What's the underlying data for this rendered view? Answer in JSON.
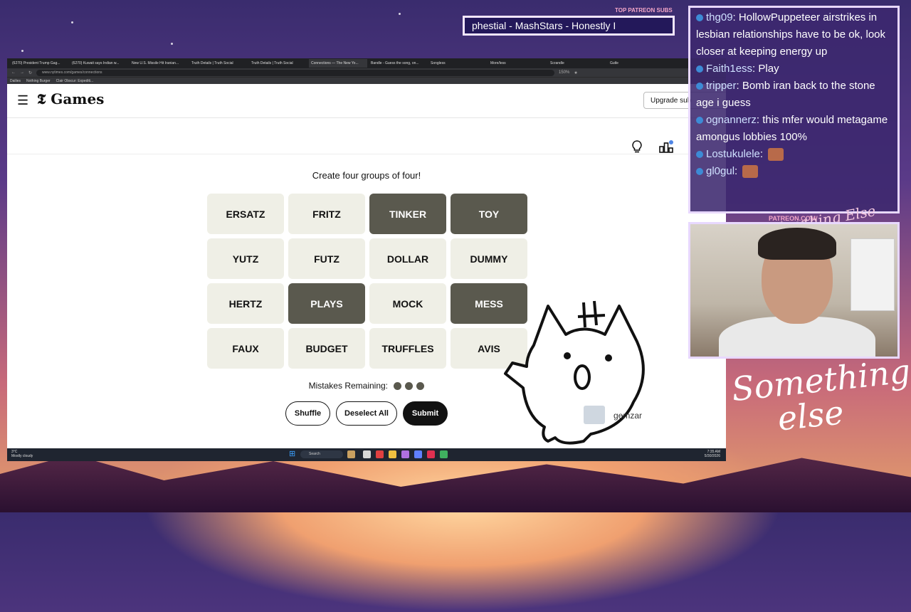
{
  "browser": {
    "tabs": [
      "(6270) President Trump Gag...",
      "(6270) Kuwait says Indian w...",
      "New U.S. Missile Hit Iranian...",
      "Truth Details | Truth Social",
      "Truth Details | Truth Social",
      "Connections — The New Yo...",
      "Bandle - Guess the song, on...",
      "Songless",
      "More/less",
      "Scrandle",
      "Gutle"
    ],
    "active_tab_index": 5,
    "url": "www.nytimes.com/games/connections",
    "bookmarks": [
      "Dailies",
      "Nothing Burger",
      "Clair Obscur: Expediti..."
    ],
    "zoom": "150%"
  },
  "header": {
    "logo": "Games",
    "upgrade_label": "Upgrade sub"
  },
  "game": {
    "instruction": "Create four groups of four!",
    "tiles": [
      {
        "word": "ERSATZ",
        "selected": false
      },
      {
        "word": "FRITZ",
        "selected": false
      },
      {
        "word": "TINKER",
        "selected": true
      },
      {
        "word": "TOY",
        "selected": true
      },
      {
        "word": "YUTZ",
        "selected": false
      },
      {
        "word": "FUTZ",
        "selected": false
      },
      {
        "word": "DOLLAR",
        "selected": false
      },
      {
        "word": "DUMMY",
        "selected": false
      },
      {
        "word": "HERTZ",
        "selected": false
      },
      {
        "word": "PLAYS",
        "selected": true
      },
      {
        "word": "MOCK",
        "selected": false
      },
      {
        "word": "MESS",
        "selected": true
      },
      {
        "word": "FAUX",
        "selected": false
      },
      {
        "word": "BUDGET",
        "selected": false
      },
      {
        "word": "TRUFFLES",
        "selected": false
      },
      {
        "word": "AVIS",
        "selected": false
      }
    ],
    "mistakes_label": "Mistakes Remaining:",
    "mistakes_remaining": 3,
    "shuffle_label": "Shuffle",
    "deselect_label": "Deselect All",
    "submit_label": "Submit"
  },
  "taskbar": {
    "weather_temp": "3°C",
    "weather_desc": "Mostly cloudy",
    "search_label": "Search",
    "time": "7:35 AM",
    "date": "5/30/2026"
  },
  "overlay": {
    "patreon_label": "TOP PATREON SUBS",
    "ticker_text": "phestial - MashStars - Honestly I",
    "chat": [
      {
        "user": "thg09",
        "msg": "HollowPuppeteer airstrikes in lesbian relationships have to be ok, look closer at keeping energy up"
      },
      {
        "user": "Faith1ess",
        "msg": "Play"
      },
      {
        "user": "tripper",
        "msg": "Bomb iran back to the stone age i guess"
      },
      {
        "user": "ognannerz",
        "msg": "this mfer would metagame amongus lobbies 100%"
      },
      {
        "user": "Lostukulele",
        "msg": ""
      },
      {
        "user": "gl0gul",
        "msg": ""
      }
    ],
    "cam_label": "PATREON.COM/",
    "cam_brand": "Anything Else",
    "brand_line1": "Something",
    "brand_line2": "else",
    "sticker_name": "gemzar"
  }
}
